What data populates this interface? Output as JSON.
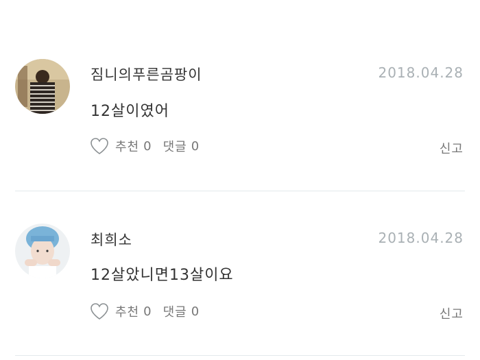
{
  "comments": [
    {
      "author": "짐니의푸른곰팡이",
      "date": "2018.04.28",
      "text": "12살이였어",
      "like_label": "추천",
      "like_count": "0",
      "reply_label": "댓글",
      "reply_count": "0",
      "report_label": "신고",
      "avatar_icon": "avatar-photo-icon",
      "like_icon": "heart-outline-icon"
    },
    {
      "author": "최희소",
      "date": "2018.04.28",
      "text": "12살았니면13살이요",
      "like_label": "추천",
      "like_count": "0",
      "reply_label": "댓글",
      "reply_count": "0",
      "report_label": "신고",
      "avatar_icon": "avatar-photo-icon",
      "like_icon": "heart-outline-icon"
    }
  ],
  "colors": {
    "date": "#a9b0b4",
    "divider": "#e3e9ec",
    "action_text": "#777777"
  }
}
